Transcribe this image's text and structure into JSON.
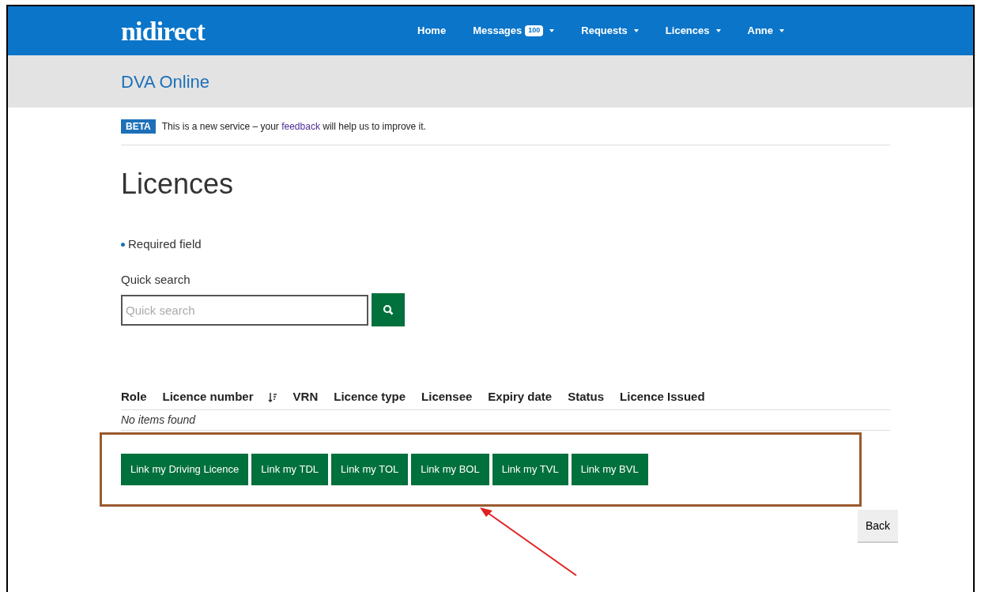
{
  "header": {
    "logo": "nidirect",
    "nav": [
      {
        "label": "Home",
        "dropdown": false
      },
      {
        "label": "Messages",
        "badge": "100",
        "dropdown": true
      },
      {
        "label": "Requests",
        "dropdown": true
      },
      {
        "label": "Licences",
        "dropdown": true
      },
      {
        "label": "Anne",
        "dropdown": true
      }
    ]
  },
  "service_title": "DVA Online",
  "beta": {
    "tag": "BETA",
    "before": "This is a new service – your",
    "link": "feedback",
    "after": "will help us to improve it."
  },
  "page_title": "Licences",
  "required_note": "Required field",
  "quick_search": {
    "label": "Quick search",
    "placeholder": "Quick search"
  },
  "table": {
    "columns": [
      {
        "label": "Role",
        "sortable": false
      },
      {
        "label": "Licence number",
        "sortable": true
      },
      {
        "label": "VRN",
        "sortable": false
      },
      {
        "label": "Licence type",
        "sortable": false
      },
      {
        "label": "Licensee",
        "sortable": false
      },
      {
        "label": "Expiry date",
        "sortable": false
      },
      {
        "label": "Status",
        "sortable": false
      },
      {
        "label": "Licence Issued",
        "sortable": false
      }
    ],
    "empty_message": "No items found"
  },
  "link_buttons": [
    "Link my Driving Licence",
    "Link my TDL",
    "Link my TOL",
    "Link my BOL",
    "Link my TVL",
    "Link my BVL"
  ],
  "back_button": "Back"
}
